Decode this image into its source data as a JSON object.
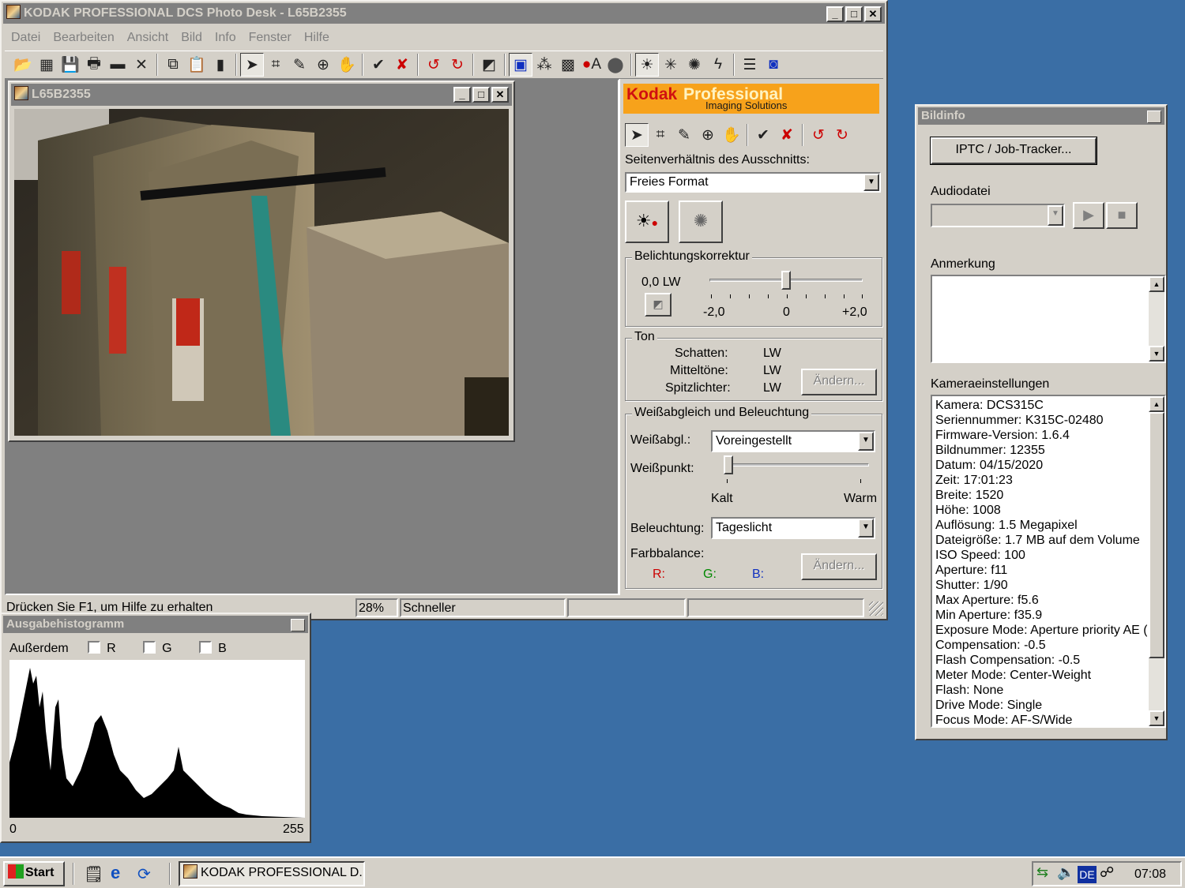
{
  "main_window": {
    "title": "KODAK PROFESSIONAL DCS Photo Desk - L65B2355",
    "menu": [
      "Datei",
      "Bearbeiten",
      "Ansicht",
      "Bild",
      "Info",
      "Fenster",
      "Hilfe"
    ],
    "status": {
      "help": "Drücken Sie F1, um Hilfe zu erhalten",
      "zoom": "28%",
      "mode": "Schneller"
    }
  },
  "image_window": {
    "title": "L65B2355"
  },
  "panel": {
    "logo_kodak": "Kodak",
    "logo_professional": "Professional",
    "logo_sub": "Imaging Solutions",
    "crop_label": "Seitenverhältnis des Ausschnitts:",
    "crop_value": "Freies Format",
    "exposure": {
      "title": "Belichtungskorrektur",
      "value": "0,0 LW",
      "min": "-2,0",
      "mid": "0",
      "max": "+2,0",
      "level": 0.5
    },
    "tone": {
      "title": "Ton",
      "shadows_label": "Schatten:",
      "shadows_value": "LW",
      "mids_label": "Mitteltöne:",
      "mids_value": "LW",
      "highlights_label": "Spitzlichter:",
      "highlights_value": "LW",
      "change": "Ändern..."
    },
    "wb": {
      "title": "Weißabgleich und Beleuchtung",
      "wb_label": "Weißabgl.:",
      "wb_value": "Voreingestellt",
      "wp_label": "Weißpunkt:",
      "cold": "Kalt",
      "warm": "Warm",
      "wp_level": 0.03,
      "light_label": "Beleuchtung:",
      "light_value": "Tageslicht",
      "balance_label": "Farbbalance:",
      "r": "R:",
      "g": "G:",
      "b": "B:",
      "change": "Ändern..."
    }
  },
  "histogram": {
    "title": "Ausgabehistogramm",
    "also": "Außerdem",
    "r": "R",
    "g": "G",
    "b": "B",
    "min": "0",
    "max": "255"
  },
  "bildinfo": {
    "title": "Bildinfo",
    "iptc": "IPTC / Job-Tracker...",
    "audio_label": "Audiodatei",
    "note_label": "Anmerkung",
    "camera_label": "Kameraeinstellungen",
    "camera": [
      "Kamera:  DCS315C",
      "Seriennummer:  K315C-02480",
      "Firmware-Version:  1.6.4",
      "Bildnummer:  12355",
      "Datum:  04/15/2020",
      "Zeit:  17:01:23",
      "Breite:  1520",
      "Höhe:  1008",
      "Auflösung:  1.5 Megapixel",
      "Dateigröße:  1.7 MB auf dem Volume",
      "ISO Speed:  100",
      "Aperture:  f11",
      "Shutter:  1/90",
      "Max Aperture:  f5.6",
      "Min Aperture:  f35.9",
      "Exposure Mode:  Aperture priority AE (A",
      "Compensation:  -0.5",
      "Flash Compensation:  -0.5",
      "Meter Mode:  Center-Weight",
      "Flash:  None",
      "Drive Mode:  Single",
      "Focus Mode:  AF-S/Wide"
    ]
  },
  "taskbar": {
    "start": "Start",
    "task": "KODAK PROFESSIONAL D...",
    "lang": "DE",
    "clock": "07:08"
  }
}
